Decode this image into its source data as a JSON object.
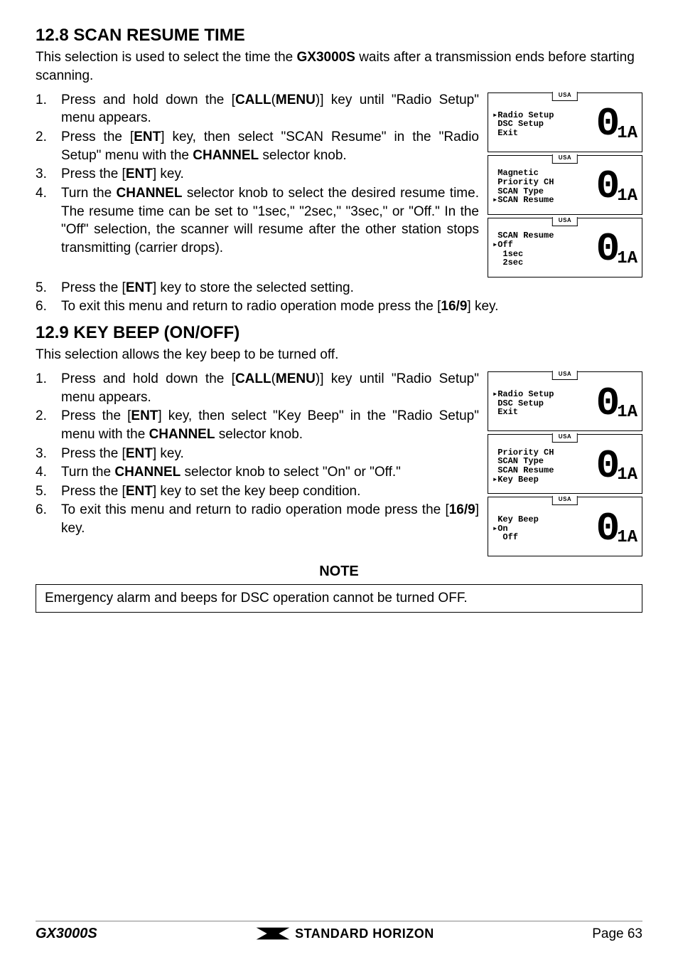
{
  "section1": {
    "title": "12.8  SCAN RESUME TIME",
    "intro_pre": "This selection is used to select the time the ",
    "intro_bold": "GX3000S",
    "intro_post": " waits after a transmission ends before starting scanning.",
    "steps": {
      "s1": {
        "n": "1.",
        "a": "Press and hold down the [",
        "b": "CALL",
        "c": "(",
        "d": "MENU",
        "e": ")] key until \"",
        "f": "Radio Setup",
        "g": "\" menu appears."
      },
      "s2": {
        "n": "2.",
        "a": "Press the [",
        "b": "ENT",
        "c": "] key, then select \"",
        "d": "SCAN Resume",
        "e": "\" in the \"",
        "f": "Radio Setup",
        "g": "\" menu with the ",
        "h": "CHANNEL",
        "i": " selector knob."
      },
      "s3": {
        "n": "3.",
        "a": "Press the [",
        "b": "ENT",
        "c": "] key."
      },
      "s4": {
        "n": "4.",
        "a": "Turn the ",
        "b": "CHANNEL",
        "c": " selector knob to select the desired resume time. The resume time can be set to \"",
        "d": "1sec",
        "e": ",\" \"",
        "f": "2sec",
        "g": ",\" \"",
        "h": "3sec",
        "i": ",\" or \"",
        "j": "Off",
        "k": ".\" In the \"",
        "l": "Off",
        "m": "\" selection, the scanner will resume after the other station stops transmitting (carrier drops)."
      },
      "s5": {
        "n": "5.",
        "a": "Press the [",
        "b": "ENT",
        "c": "] key to  store the selected setting."
      },
      "s6": {
        "n": "6.",
        "a": "To exit this menu and return to radio operation mode press the [",
        "b": "16/9",
        "c": "] key."
      }
    },
    "screens": {
      "tab": "USA",
      "scr1": "▸Radio Setup\n DSC Setup\n Exit",
      "scr2": " Magnetic\n Priority CH\n SCAN Type\n▸SCAN Resume",
      "scr3": " SCAN Resume\n▸Off\n  1sec\n  2sec",
      "digit": "0",
      "sub": "1A"
    }
  },
  "section2": {
    "title": "12.9  KEY BEEP (ON/OFF)",
    "intro": "This selection allows the key beep to be turned off.",
    "steps": {
      "s1": {
        "n": "1.",
        "a": "Press and hold down the [",
        "b": "CALL",
        "c": "(",
        "d": "MENU",
        "e": ")] key until \"",
        "f": "Radio Setup",
        "g": "\" menu appears."
      },
      "s2": {
        "n": "2.",
        "a": "Press the [",
        "b": "ENT",
        "c": "] key, then select \"",
        "d": "Key Beep",
        "e": "\" in the \"",
        "f": "Radio Setup",
        "g": "\" menu with the ",
        "h": "CHANNEL",
        "i": " selector knob."
      },
      "s3": {
        "n": "3.",
        "a": "Press the [",
        "b": "ENT",
        "c": "] key."
      },
      "s4": {
        "n": "4.",
        "a": "Turn the ",
        "b": "CHANNEL",
        "c": " selector knob to select \"",
        "d": "On",
        "e": "\" or \"",
        "f": "Off",
        "g": ".\""
      },
      "s5": {
        "n": "5.",
        "a": "Press the [",
        "b": "ENT",
        "c": "] key to set the key beep condition."
      },
      "s6": {
        "n": "6.",
        "a": "To exit this menu and return to radio operation mode press the [",
        "b": "16/9",
        "c": "] key."
      }
    },
    "screens": {
      "tab": "USA",
      "scr1": "▸Radio Setup\n DSC Setup\n Exit",
      "scr2": " Priority CH\n SCAN Type\n SCAN Resume\n▸Key Beep",
      "scr3": " Key Beep\n▸On\n  Off",
      "digit": "0",
      "sub": "1A"
    }
  },
  "note": {
    "title": "NOTE",
    "text": "Emergency alarm and beeps for DSC operation cannot be turned OFF."
  },
  "footer": {
    "left": "GX3000S",
    "brand": "STANDARD HORIZON",
    "right": "Page 63"
  }
}
